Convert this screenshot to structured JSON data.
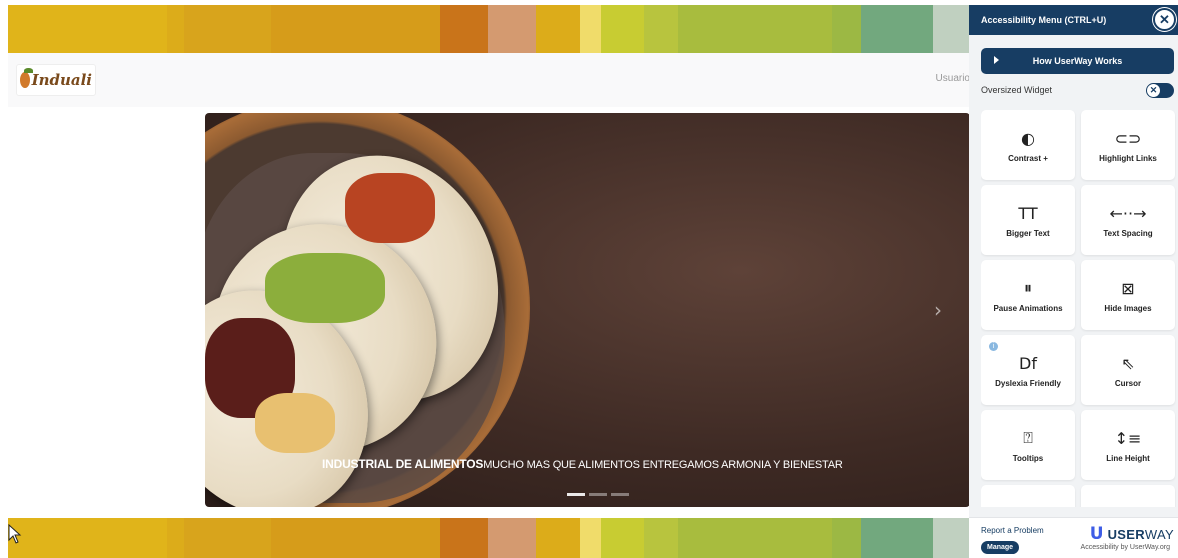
{
  "colors": {
    "stripe": [
      "#e0b41a",
      "#dcac1a",
      "#d8a41c",
      "#d69c1a",
      "#c9741a",
      "#d49a70",
      "#dcac1a",
      "#f0dc6a",
      "#c8cc32",
      "#b8c43e",
      "#a8bc3e",
      "#9cb844",
      "#72a87e",
      "#c0d0c0"
    ],
    "panel_accent": "#173d63",
    "userway_blue": "#3e5de6"
  },
  "header": {
    "logo_text": "Induali",
    "user_link": "Usuario"
  },
  "hero": {
    "caption_bold": "INDUSTRIAL DE ALIMENTOS",
    "caption_rest": "MUCHO MAS QUE ALIMENTOS ENTREGAMOS ARMONIA Y BIENESTAR",
    "next_arrow": "›",
    "slides_total": 3,
    "active_slide": 1
  },
  "panel": {
    "title": "Accessibility Menu (CTRL+U)",
    "close_glyph": "✕",
    "how_button": "How UserWay Works",
    "oversized_label": "Oversized Widget",
    "oversized_on": false,
    "toggle_glyph": "✕",
    "tiles": [
      {
        "label": "Contrast +",
        "icon": "contrast-icon",
        "glyph": "◐"
      },
      {
        "label": "Highlight Links",
        "icon": "link-icon",
        "glyph": "⊂⊃"
      },
      {
        "label": "Bigger Text",
        "icon": "text-size-icon",
        "glyph": "TT"
      },
      {
        "label": "Text Spacing",
        "icon": "text-spacing-icon",
        "glyph": "←··→"
      },
      {
        "label": "Pause Animations",
        "icon": "pause-icon",
        "glyph": "⏸"
      },
      {
        "label": "Hide Images",
        "icon": "hide-image-icon",
        "glyph": "⊠"
      },
      {
        "label": "Dyslexia Friendly",
        "icon": "dyslexia-icon",
        "glyph": "Df"
      },
      {
        "label": "Cursor",
        "icon": "cursor-icon",
        "glyph": "⇖"
      },
      {
        "label": "Tooltips",
        "icon": "tooltip-icon",
        "glyph": "⍰"
      },
      {
        "label": "Line Height",
        "icon": "line-height-icon",
        "glyph": "↕≡"
      },
      {
        "label": "",
        "icon": "align-icon",
        "glyph": "═"
      },
      {
        "label": "",
        "icon": "saturation-icon",
        "glyph": "▲"
      }
    ],
    "info_glyph": "i",
    "report": "Report a Problem",
    "manage": "Manage",
    "brand_bold": "USER",
    "brand_light": "WAY",
    "brand_sub": "Accessibility by UserWay.org",
    "brand_u": "U"
  }
}
